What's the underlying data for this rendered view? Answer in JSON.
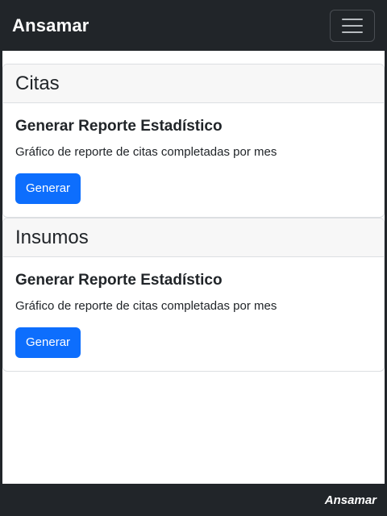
{
  "navbar": {
    "brand": "Ansamar",
    "toggler_icon": "menu-icon"
  },
  "cards": [
    {
      "header": "Citas",
      "title": "Generar Reporte Estadístico",
      "text": "Gráfico de reporte de citas completadas por mes",
      "button_label": "Generar"
    },
    {
      "header": "Insumos",
      "title": "Generar Reporte Estadístico",
      "text": "Gráfico de reporte de citas completadas por mes",
      "button_label": "Generar"
    }
  ],
  "footer": {
    "brand": "Ansamar"
  },
  "colors": {
    "navbar_bg": "#212529",
    "primary": "#0d6efd",
    "card_header_bg": "#f7f7f7"
  }
}
